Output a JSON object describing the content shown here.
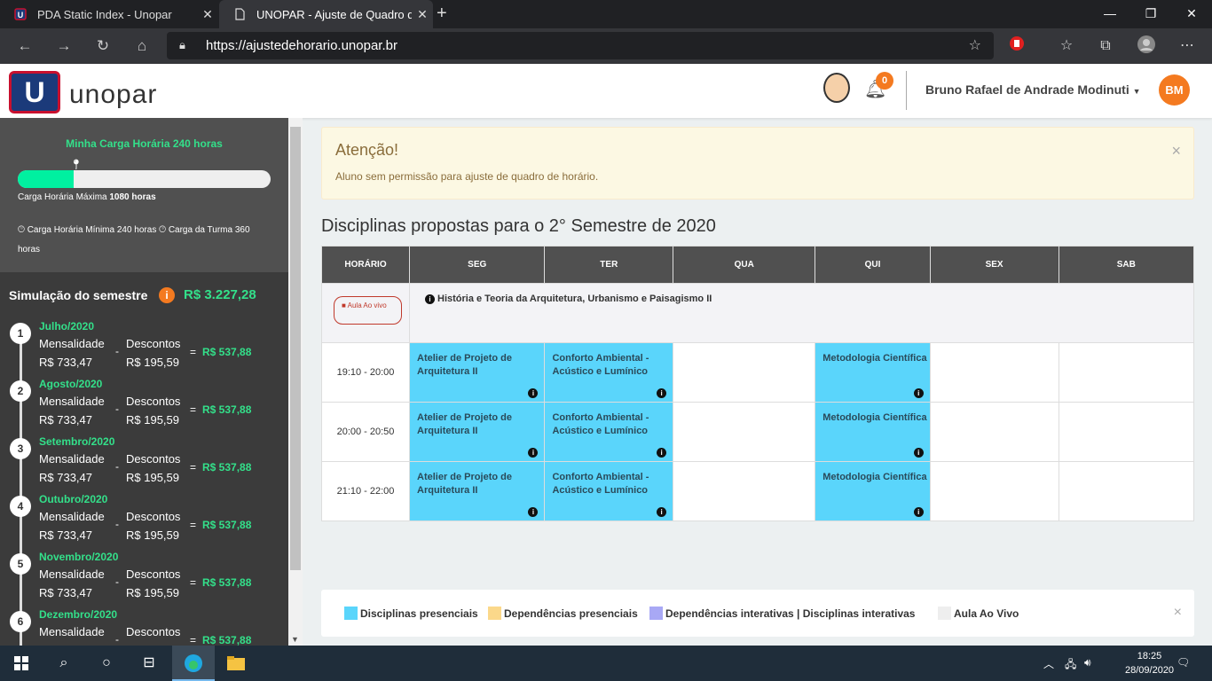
{
  "browser": {
    "tab1_title": "PDA Static Index - Unopar",
    "tab2_title": "UNOPAR - Ajuste de Quadro de",
    "url": "https://ajustedehorario.unopar.br"
  },
  "header": {
    "brand": "unopar",
    "logo_letter": "U",
    "notif_count": "0",
    "user_name": "Bruno Rafael de Andrade Modinuti",
    "user_initials": "BM"
  },
  "sidebar": {
    "carga_title": "Minha Carga Horária 240 horas",
    "carga_progress_fraction": 0.22,
    "carga_max_label": "Carga Horária Máxima",
    "carga_max_value": "1080 horas",
    "carga_min": "Carga Horária Mínima 240 horas",
    "carga_turma": "Carga da Turma 360 horas",
    "sim_title": "Simulação do semestre",
    "sim_total": "R$ 3.227,28",
    "months": [
      {
        "num": "1",
        "name": "Julho/2020",
        "label1": "Mensalidade",
        "val1": "R$ 733,47",
        "label2": "Descontos",
        "val2": "R$ 195,59",
        "total": "R$ 537,88"
      },
      {
        "num": "2",
        "name": "Agosto/2020",
        "label1": "Mensalidade",
        "val1": "R$ 733,47",
        "label2": "Descontos",
        "val2": "R$ 195,59",
        "total": "R$ 537,88"
      },
      {
        "num": "3",
        "name": "Setembro/2020",
        "label1": "Mensalidade",
        "val1": "R$ 733,47",
        "label2": "Descontos",
        "val2": "R$ 195,59",
        "total": "R$ 537,88"
      },
      {
        "num": "4",
        "name": "Outubro/2020",
        "label1": "Mensalidade",
        "val1": "R$ 733,47",
        "label2": "Descontos",
        "val2": "R$ 195,59",
        "total": "R$ 537,88"
      },
      {
        "num": "5",
        "name": "Novembro/2020",
        "label1": "Mensalidade",
        "val1": "R$ 733,47",
        "label2": "Descontos",
        "val2": "R$ 195,59",
        "total": "R$ 537,88"
      },
      {
        "num": "6",
        "name": "Dezembro/2020",
        "label1": "Mensalidade",
        "val1": "",
        "label2": "Descontos",
        "val2": "",
        "total": "R$ 537,88"
      }
    ]
  },
  "alert": {
    "title": "Atenção!",
    "body": "Aluno sem permissão para ajuste de quadro de horário."
  },
  "schedule": {
    "title": "Disciplinas propostas para o 2° Semestre de 2020",
    "headers": [
      "HORÁRIO",
      "SEG",
      "TER",
      "QUA",
      "QUI",
      "SEX",
      "SAB"
    ],
    "live_label": "Aula Ao vivo",
    "live_subject": "História e Teoria da Arquitetura, Urbanismo e Paisagismo II",
    "rows": [
      {
        "time": "19:10 - 20:00",
        "seg": "Atelier de Projeto de Arquitetura II",
        "ter": "Conforto Ambiental - Acústico e Lumínico",
        "qui": "Metodologia Científica"
      },
      {
        "time": "20:00 - 20:50",
        "seg": "Atelier de Projeto de Arquitetura II",
        "ter": "Conforto Ambiental - Acústico e Lumínico",
        "qui": "Metodologia Científica"
      },
      {
        "time": "21:10 - 22:00",
        "seg": "Atelier de Projeto de Arquitetura II",
        "ter": "Conforto Ambiental - Acústico e Lumínico",
        "qui": "Metodologia Científica"
      }
    ]
  },
  "legend": {
    "presenciais": "Disciplinas presenciais",
    "dep_presenciais": "Dependências presenciais",
    "interativas": "Dependências interativas | Disciplinas interativas",
    "aovivo": "Aula Ao Vivo"
  },
  "colors": {
    "presencial": "#5ad5fb",
    "dep_presencial": "#fbd88a",
    "interativa": "#a8a8f5",
    "aovivo": "#eeeeee"
  },
  "taskbar": {
    "time": "18:25",
    "date": "28/09/2020"
  }
}
